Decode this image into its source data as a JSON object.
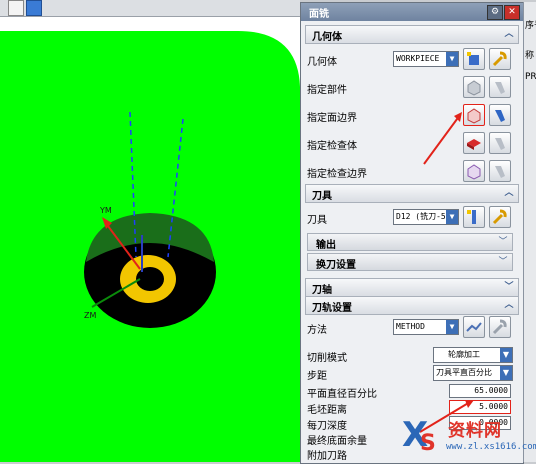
{
  "dialog": {
    "title": "面铣",
    "sections": {
      "geometry": {
        "header": "几何体",
        "geometry_label": "几何体",
        "geometry_value": "WORKPIECE",
        "specify_part": "指定部件",
        "specify_face_boundary": "指定面边界",
        "specify_check_body": "指定检查体",
        "specify_check_boundary": "指定检查边界"
      },
      "tool": {
        "header": "刀具",
        "tool_label": "刀具",
        "tool_value": "D12 (铣刀-5",
        "output_label": "输出",
        "tool_change_label": "换刀设置"
      },
      "tool_axis": {
        "header": "刀轴"
      },
      "tool_path": {
        "header": "刀轨设置",
        "method_label": "方法",
        "method_value": "METHOD",
        "cut_pattern_label": "切削模式",
        "cut_pattern_value": "轮廓加工",
        "stepover_label": "步距",
        "stepover_value": "刀具平直百分比",
        "percent_flat_label": "平面直径百分比",
        "percent_flat_value": "65.0000",
        "blank_distance_label": "毛坯距离",
        "blank_distance_value": "5.0000",
        "depth_per_cut_label": "每刀深度",
        "depth_per_cut_value": "0.0000",
        "final_floor_stock_label": "最终底面余量",
        "extra_passes_label": "附加刀路"
      }
    }
  },
  "right_panel": {
    "line1": "序号",
    "line2": "称",
    "line3": "PR"
  },
  "viewport": {
    "axis_label_ym": "YM",
    "axis_label_zm": "ZM"
  },
  "watermark": {
    "text": "资料网",
    "url": "www.zl.xs1616.com"
  },
  "colors": {
    "viewport_green": "#00ff00",
    "part_yellow": "#f2c600",
    "dialog_title": "#7b8daa",
    "annotation_red": "#e2231a"
  }
}
